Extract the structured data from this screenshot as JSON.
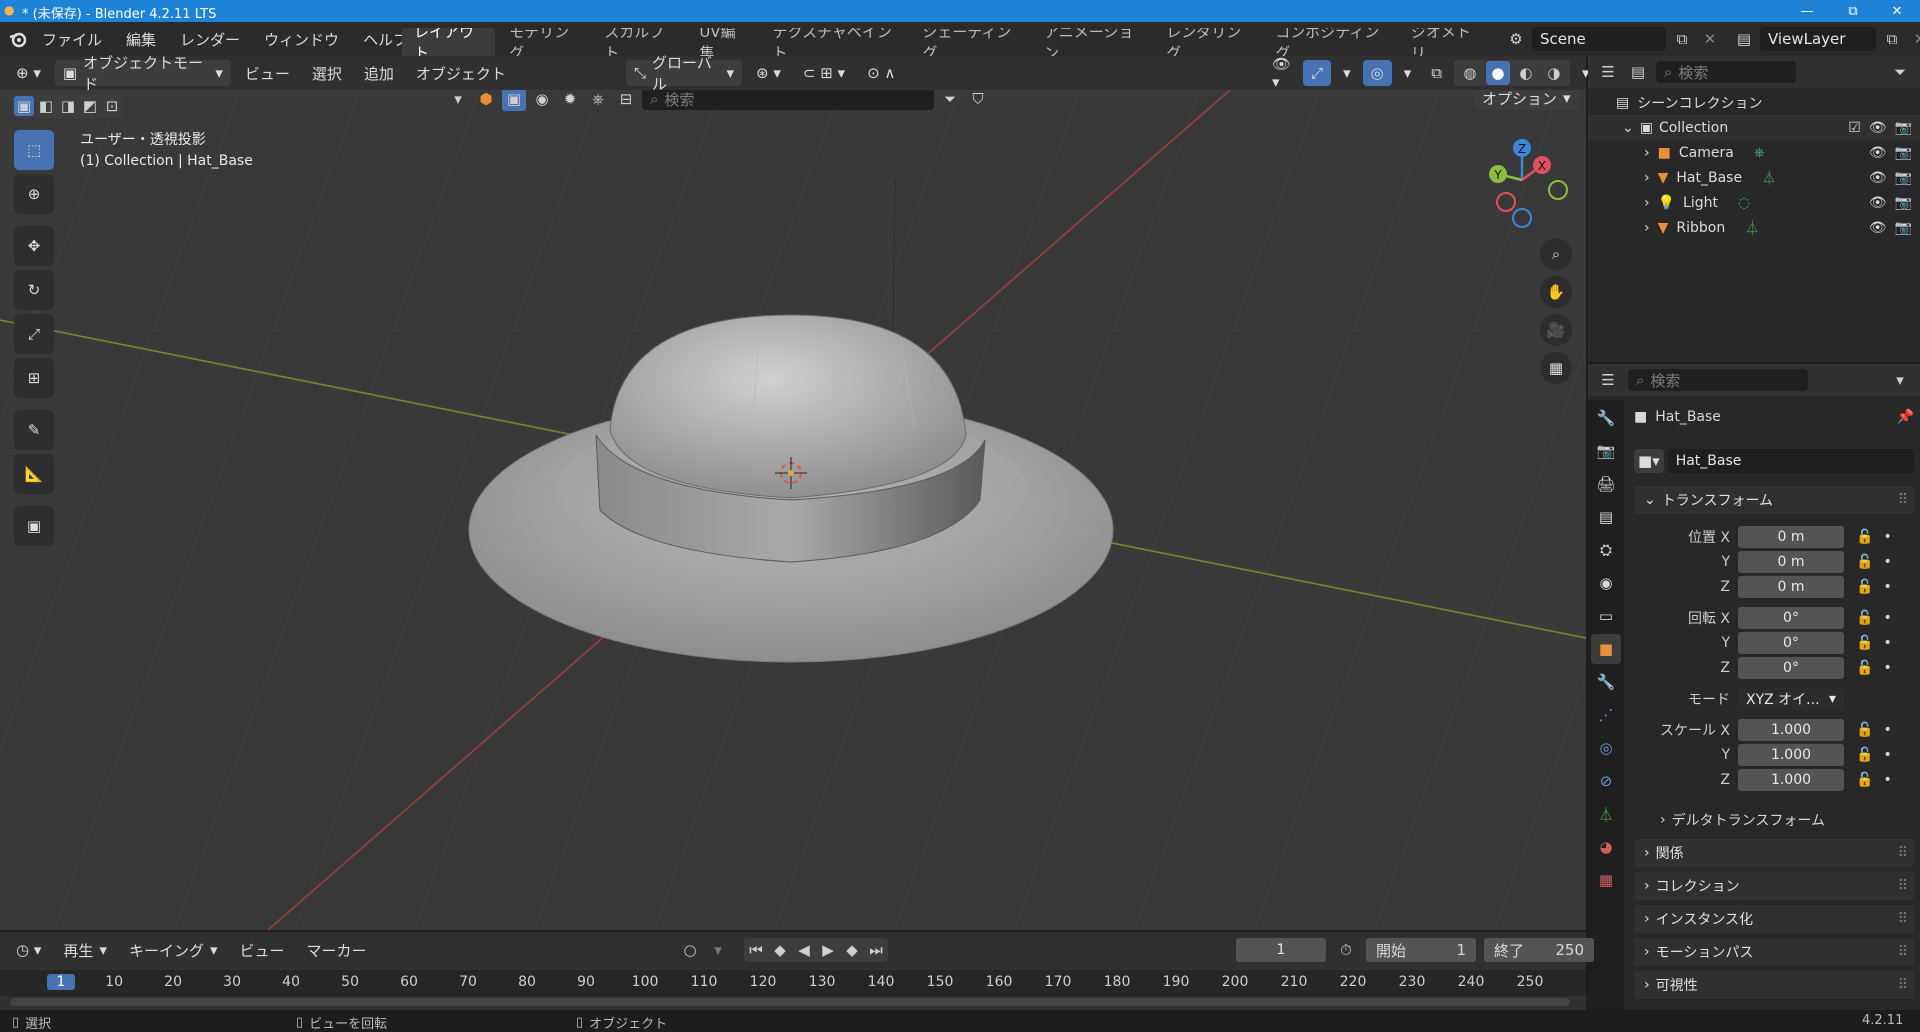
{
  "window": {
    "title": "* (未保存) - Blender 4.2.11 LTS",
    "minimize": "—",
    "maximize": "⧉",
    "close": "✕"
  },
  "menus": [
    "ファイル",
    "編集",
    "レンダー",
    "ウィンドウ",
    "ヘルプ"
  ],
  "workspaces": [
    "レイアウト",
    "モデリング",
    "スカルプト",
    "UV編集",
    "テクスチャペイント",
    "シェーディング",
    "アニメーション",
    "レンダリング",
    "コンポジティング",
    "ジオメトリ"
  ],
  "scene": {
    "name": "Scene",
    "view_layer": "ViewLayer"
  },
  "viewport_header": {
    "mode": "オブジェクトモード",
    "menus": [
      "ビュー",
      "選択",
      "追加",
      "オブジェクト"
    ],
    "transform": "グローバル",
    "search_placeholder": "検索",
    "options": "オプション"
  },
  "viewport": {
    "view_name": "ユーザー・透視投影",
    "collection_info": "(1) Collection | Hat_Base",
    "gizmo": {
      "x": "X",
      "y": "Y",
      "z": "Z"
    }
  },
  "outliner": {
    "search_placeholder": "検索",
    "scene_collection": "シーンコレクション",
    "collection": "Collection",
    "items": [
      {
        "name": "Camera",
        "type": "camera"
      },
      {
        "name": "Hat_Base",
        "type": "mesh"
      },
      {
        "name": "Light",
        "type": "light"
      },
      {
        "name": "Ribbon",
        "type": "mesh"
      }
    ]
  },
  "properties": {
    "search_placeholder": "検索",
    "object_name": "Hat_Base",
    "datablock": "Hat_Base",
    "transform_title": "トランスフォーム",
    "location": {
      "label": "位置 X",
      "x": "0 m",
      "y": "0 m",
      "z": "0 m"
    },
    "rotation": {
      "label": "回転 X",
      "x": "0°",
      "y": "0°",
      "z": "0°"
    },
    "mode_label": "モード",
    "mode_value": "XYZ オイ...",
    "scale": {
      "label": "スケール X",
      "x": "1.000",
      "y": "1.000",
      "z": "1.000"
    },
    "axis_y": "Y",
    "axis_z": "Z",
    "delta": "デルタトランスフォーム",
    "sections": [
      "関係",
      "コレクション",
      "インスタンス化",
      "モーションパス",
      "可視性"
    ]
  },
  "timeline": {
    "playback": "再生",
    "keying": "キーイング",
    "view": "ビュー",
    "marker": "マーカー",
    "current_frame": "1",
    "start_label": "開始",
    "start": "1",
    "end_label": "終了",
    "end": "250",
    "ruler": [
      "1",
      "10",
      "20",
      "30",
      "40",
      "50",
      "60",
      "70",
      "80",
      "90",
      "100",
      "110",
      "120",
      "130",
      "140",
      "150",
      "160",
      "170",
      "180",
      "190",
      "200",
      "210",
      "220",
      "230",
      "240",
      "250"
    ]
  },
  "status": {
    "select": "選択",
    "rotate": "ビューを回転",
    "object": "オブジェクト",
    "version": "4.2.11"
  },
  "colors": {
    "accent": "#4772b3",
    "titlebar": "#1e83d6",
    "x_axis": "#e24f5c",
    "y_axis": "#8cbd3d",
    "z_axis": "#3d86d9",
    "object_orange": "#e8913a"
  }
}
